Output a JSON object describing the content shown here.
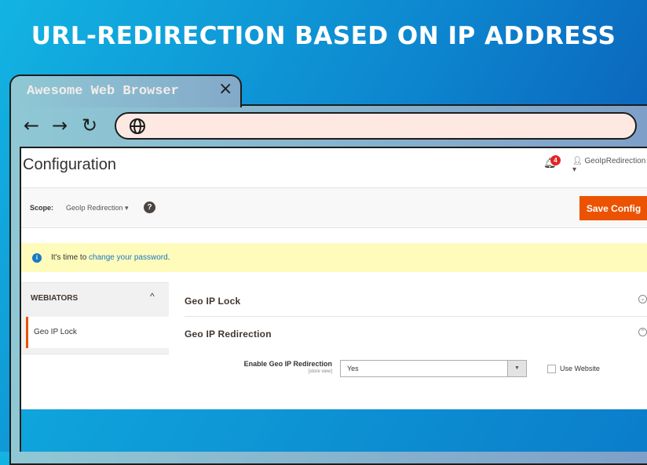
{
  "headline": "URL-REDIRECTION BASED ON IP ADDRESS",
  "browser": {
    "tab_title": "Awesome Web Browser",
    "close_icon": "×",
    "back_icon": "←",
    "forward_icon": "→",
    "reload_icon": "↻",
    "globe_icon": "🌐",
    "address": ""
  },
  "admin": {
    "page_title": "Configuration",
    "notification_count": "4",
    "user_name": "GeoIpRedirection ▾",
    "scope_label": "Scope:",
    "scope_value": "GeoIp Redirection ▾",
    "help_icon": "?",
    "save_label": "Save Config",
    "notice_prefix": "It's time to ",
    "notice_link": "change your password",
    "notice_suffix": ".",
    "sidebar": {
      "header": "WEBIATORS",
      "items": [
        {
          "label": "Geo IP Lock",
          "active": true
        }
      ]
    },
    "sections": [
      {
        "title": "Geo IP Lock",
        "state": "collapsed",
        "icon": "⌄"
      },
      {
        "title": "Geo IP Redirection",
        "state": "expanded",
        "icon": "⌃"
      }
    ],
    "field": {
      "label": "Enable Geo IP Redirection",
      "scope": "[store view]",
      "value": "Yes",
      "use_website_label": "Use Website",
      "use_website_checked": false
    },
    "colors": {
      "accent": "#eb5202",
      "link": "#1979c3",
      "notice_bg": "#fffbbb"
    }
  }
}
